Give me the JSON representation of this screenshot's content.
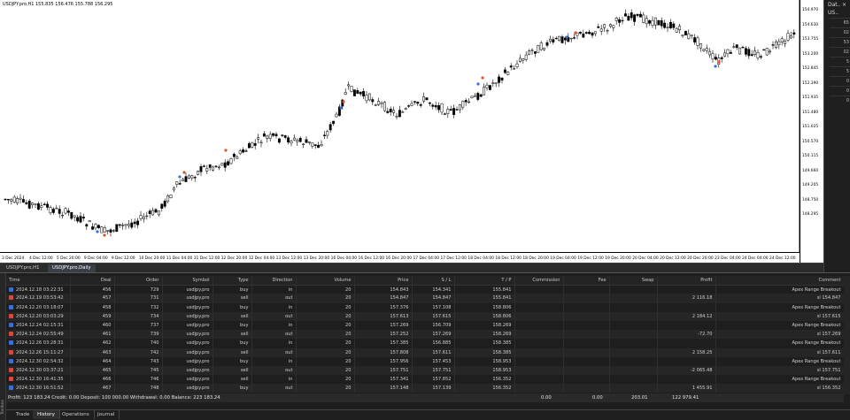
{
  "chart": {
    "title": "USDJPY.pro,H1  155.835  156.476  155.788  156.295",
    "price_labels": [
      "154.970",
      "154.630",
      "153.755",
      "153.200",
      "152.845",
      "152.390",
      "151.935",
      "151.480",
      "151.025",
      "150.570",
      "150.115",
      "149.660",
      "149.205",
      "148.750",
      "148.295"
    ],
    "time_labels": [
      "3 Dec 2024",
      "4 Dec 12:00",
      "5 Dec 20:00",
      "9 Dec 04:00",
      "9 Dec 12:00",
      "10 Dec 20:00",
      "11 Dec 04:00",
      "11 Dec 12:00",
      "12 Dec 20:00",
      "12 Dec 04:00",
      "13 Dec 12:00",
      "13 Dec 20:00",
      "16 Dec 04:00",
      "16 Dec 12:00",
      "16 Dec 20:00",
      "17 Dec 04:00",
      "17 Dec 12:00",
      "18 Dec 04:00",
      "18 Dec 12:00",
      "18 Dec 20:00",
      "19 Dec 04:00",
      "19 Dec 12:00",
      "19 Dec 20:00",
      "20 Dec 04:00",
      "20 Dec 12:00",
      "20 Dec 20:00",
      "23 Dec 04:00",
      "24 Dec 04:00",
      "24 Dec 12:00"
    ],
    "colors": {
      "bull": "#ffffff",
      "bear": "#000000",
      "buy_marker": "#3a6fd8",
      "sell_marker": "#e0502d"
    }
  },
  "chart_tabs": [
    "USDJPY.pro,H1",
    "USDJPY.pro,Daily"
  ],
  "right_panel": {
    "title": "Dat..",
    "close": "×",
    "symbol": "US..",
    "rows": [
      "65",
      "02",
      "53",
      "02",
      "5",
      "5",
      "0",
      "0",
      "0"
    ]
  },
  "toolbox": {
    "side_label": "Toolbox",
    "columns": [
      "Time",
      "Deal",
      "Order",
      "Symbol",
      "Type",
      "Direction",
      "Volume",
      "Price",
      "S / L",
      "T / P",
      "Commission",
      "Fee",
      "Swap",
      "Profit",
      "Comment"
    ],
    "rows": [
      {
        "time": "2024.12.18 03:22:31",
        "deal": "456",
        "order": "729",
        "symbol": "usdjpy.pro",
        "type": "buy",
        "direction": "in",
        "volume": "20",
        "price": "154.843",
        "sl": "154.341",
        "tp": "155.841",
        "commission": "",
        "fee": "",
        "swap": "",
        "profit": "",
        "comment": "Apex Range Breakout"
      },
      {
        "time": "2024.12.19 03:53:42",
        "deal": "457",
        "order": "731",
        "symbol": "usdjpy.pro",
        "type": "sell",
        "direction": "out",
        "volume": "20",
        "price": "154.847",
        "sl": "154.847",
        "tp": "155.841",
        "commission": "",
        "fee": "",
        "swap": "",
        "profit": "2 116.18",
        "comment": "sl 154.847"
      },
      {
        "time": "2024.12.20 03:18:07",
        "deal": "458",
        "order": "732",
        "symbol": "usdjpy.pro",
        "type": "buy",
        "direction": "in",
        "volume": "20",
        "price": "157.376",
        "sl": "157.108",
        "tp": "158.806",
        "commission": "",
        "fee": "",
        "swap": "",
        "profit": "",
        "comment": "Apex Range Breakout"
      },
      {
        "time": "2024.12.20 03:03:29",
        "deal": "459",
        "order": "734",
        "symbol": "usdjpy.pro",
        "type": "sell",
        "direction": "out",
        "volume": "20",
        "price": "157.613",
        "sl": "157.615",
        "tp": "158.806",
        "commission": "",
        "fee": "",
        "swap": "",
        "profit": "2 184.12",
        "comment": "sl 157.615"
      },
      {
        "time": "2024.12.24 02:15:31",
        "deal": "460",
        "order": "737",
        "symbol": "usdjpy.pro",
        "type": "buy",
        "direction": "in",
        "volume": "20",
        "price": "157.269",
        "sl": "156.709",
        "tp": "158.269",
        "commission": "",
        "fee": "",
        "swap": "",
        "profit": "",
        "comment": "Apex Range Breakout"
      },
      {
        "time": "2024.12.24 02:55:49",
        "deal": "461",
        "order": "739",
        "symbol": "usdjpy.pro",
        "type": "sell",
        "direction": "out",
        "volume": "20",
        "price": "157.252",
        "sl": "157.269",
        "tp": "158.269",
        "commission": "",
        "fee": "",
        "swap": "",
        "profit": "-72.70",
        "comment": "sl 157.269"
      },
      {
        "time": "2024.12.26 03:28:31",
        "deal": "462",
        "order": "740",
        "symbol": "usdjpy.pro",
        "type": "buy",
        "direction": "in",
        "volume": "20",
        "price": "157.385",
        "sl": "156.885",
        "tp": "158.385",
        "commission": "",
        "fee": "",
        "swap": "",
        "profit": "",
        "comment": "Apex Range Breakout"
      },
      {
        "time": "2024.12.26 15:11:27",
        "deal": "463",
        "order": "742",
        "symbol": "usdjpy.pro",
        "type": "sell",
        "direction": "out",
        "volume": "20",
        "price": "157.808",
        "sl": "157.611",
        "tp": "158.385",
        "commission": "",
        "fee": "",
        "swap": "",
        "profit": "2 158.25",
        "comment": "sl 157.611"
      },
      {
        "time": "2024.12.30 02:54:32",
        "deal": "464",
        "order": "743",
        "symbol": "usdjpy.pro",
        "type": "buy",
        "direction": "in",
        "volume": "20",
        "price": "157.956",
        "sl": "157.453",
        "tp": "158.953",
        "commission": "",
        "fee": "",
        "swap": "",
        "profit": "",
        "comment": "Apex Range Breakout"
      },
      {
        "time": "2024.12.30 03:37:21",
        "deal": "465",
        "order": "745",
        "symbol": "usdjpy.pro",
        "type": "sell",
        "direction": "out",
        "volume": "20",
        "price": "157.751",
        "sl": "157.751",
        "tp": "158.953",
        "commission": "",
        "fee": "",
        "swap": "",
        "profit": "-2 065.48",
        "comment": "sl 157.751"
      },
      {
        "time": "2024.12.30 16:41:35",
        "deal": "466",
        "order": "746",
        "symbol": "usdjpy.pro",
        "type": "sell",
        "direction": "in",
        "volume": "20",
        "price": "157.341",
        "sl": "157.852",
        "tp": "156.352",
        "commission": "",
        "fee": "",
        "swap": "",
        "profit": "",
        "comment": "Apex Range Breakout"
      },
      {
        "time": "2024.12.30 16:51:52",
        "deal": "467",
        "order": "748",
        "symbol": "usdjpy.pro",
        "type": "buy",
        "direction": "out",
        "volume": "20",
        "price": "157.148",
        "sl": "157.139",
        "tp": "156.352",
        "commission": "",
        "fee": "",
        "swap": "",
        "profit": "1 455.91",
        "comment": "sl 156.352"
      }
    ],
    "summary": {
      "text": "Profit: 123 183.24  Credit: 0.00  Deposit: 100 000.00  Withdrawal: 0.00  Balance: 223 183.24",
      "commission": "0.00",
      "fee": "0.00",
      "swap": "203.01",
      "profit": "122 979.41"
    },
    "tabs": [
      "Trade",
      "History",
      "Operations",
      "Journal"
    ],
    "active_tab": "History"
  }
}
